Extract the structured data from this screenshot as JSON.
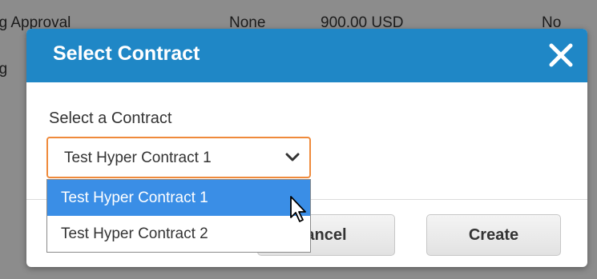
{
  "background_table": {
    "rows": [
      [
        "ng Approval",
        "None",
        "900.00 USD",
        "No"
      ],
      [
        "ng",
        "",
        "",
        ""
      ]
    ]
  },
  "modal": {
    "title": "Select Contract",
    "close_icon": "close-icon",
    "field_label": "Select a Contract",
    "select": {
      "value": "Test Hyper Contract 1",
      "options": [
        "Test Hyper Contract 1",
        "Test Hyper Contract 2"
      ],
      "highlighted_index": 0
    },
    "buttons": {
      "cancel_label": "ancel",
      "create_label": "Create"
    }
  },
  "colors": {
    "header": "#1f87c6",
    "select_border": "#ef8a3b",
    "option_highlight": "#3a8ee6"
  }
}
